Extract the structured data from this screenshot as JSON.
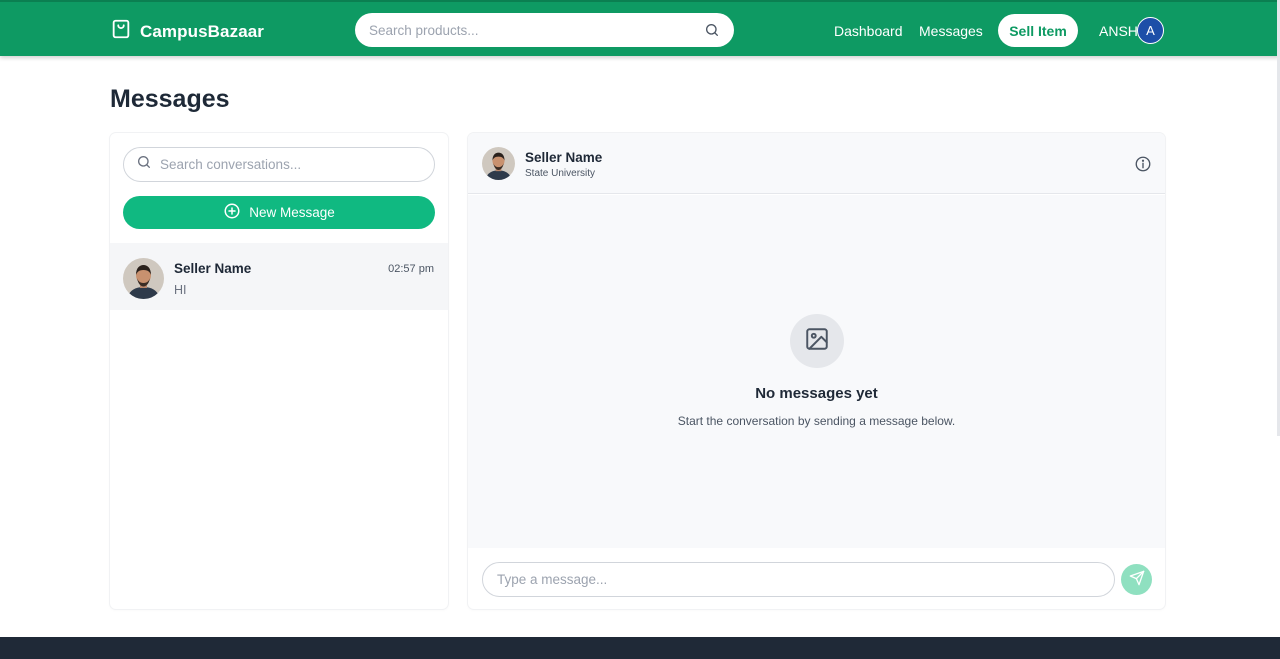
{
  "header": {
    "brand": "CampusBazaar",
    "search_placeholder": "Search products...",
    "nav": {
      "dashboard": "Dashboard",
      "messages": "Messages"
    },
    "sell_button": "Sell Item",
    "user_name": "ANSH",
    "user_initial": "A"
  },
  "page": {
    "title": "Messages"
  },
  "sidebar": {
    "search_placeholder": "Search conversations...",
    "new_message_label": "New Message",
    "conversations": [
      {
        "name": "Seller Name",
        "time": "02:57 pm",
        "preview": "HI"
      }
    ]
  },
  "chat": {
    "name": "Seller Name",
    "subtitle": "State University",
    "empty_title": "No messages yet",
    "empty_subtitle": "Start the conversation by sending a message below.",
    "input_placeholder": "Type a message..."
  },
  "colors": {
    "header_bg": "#0e9a63",
    "accent": "#10b981",
    "send_button": "#8fe0c0",
    "footer_bg": "#1f2937",
    "avatar_bg": "#1d4fa8"
  },
  "icons": [
    "shopping-bag-icon",
    "search-icon",
    "plus-circle-icon",
    "info-icon",
    "image-icon",
    "send-icon"
  ]
}
